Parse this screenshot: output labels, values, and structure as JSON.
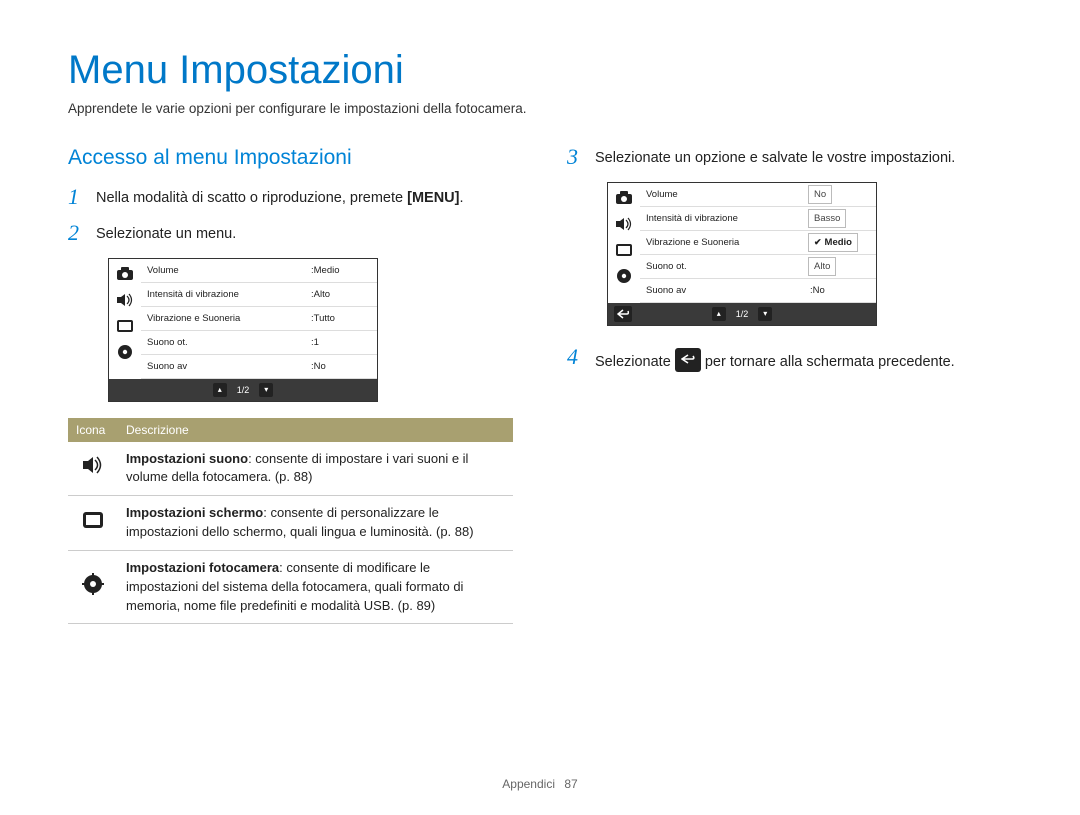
{
  "title": "Menu Impostazioni",
  "subtitle": "Apprendete le varie opzioni per configurare le impostazioni della fotocamera.",
  "left": {
    "heading": "Accesso al menu Impostazioni",
    "step1_a": "Nella modalità di scatto o riproduzione, premete ",
    "step1_menu": "[MENU]",
    "step1_b": ".",
    "step2": "Selezionate un menu."
  },
  "cam1": {
    "rows": [
      {
        "label": "Volume",
        "value": ":Medio"
      },
      {
        "label": "Intensità di vibrazione",
        "value": ":Alto"
      },
      {
        "label": "Vibrazione e Suoneria",
        "value": ":Tutto"
      },
      {
        "label": "Suono ot.",
        "value": ":1"
      },
      {
        "label": "Suono av",
        "value": ":No"
      }
    ],
    "page": "1/2"
  },
  "table": {
    "h1": "Icona",
    "h2": "Descrizione",
    "rows": [
      {
        "bold": "Impostazioni suono",
        "rest": ": consente di impostare i vari suoni e il volume della fotocamera. (p. 88)"
      },
      {
        "bold": "Impostazioni schermo",
        "rest": ": consente di personalizzare le impostazioni dello schermo, quali lingua e luminosità. (p. 88)"
      },
      {
        "bold": "Impostazioni fotocamera",
        "rest": ": consente di modificare le impostazioni del sistema della fotocamera, quali formato di memoria, nome file predefiniti e modalità USB. (p. 89)"
      }
    ]
  },
  "right": {
    "step3": "Selezionate un opzione e salvate le vostre impostazioni.",
    "step4_a": "Selezionate ",
    "step4_b": " per tornare alla schermata precedente."
  },
  "cam2": {
    "rows": [
      {
        "label": "Volume",
        "value": "No"
      },
      {
        "label": "Intensità di vibrazione",
        "value": "Basso"
      },
      {
        "label": "Vibrazione e Suoneria",
        "value": "Medio",
        "sel": true
      },
      {
        "label": "Suono ot.",
        "value": "Alto"
      },
      {
        "label": "Suono av",
        "value": ":No"
      }
    ],
    "page": "1/2"
  },
  "footer": {
    "section": "Appendici",
    "page": "87"
  }
}
